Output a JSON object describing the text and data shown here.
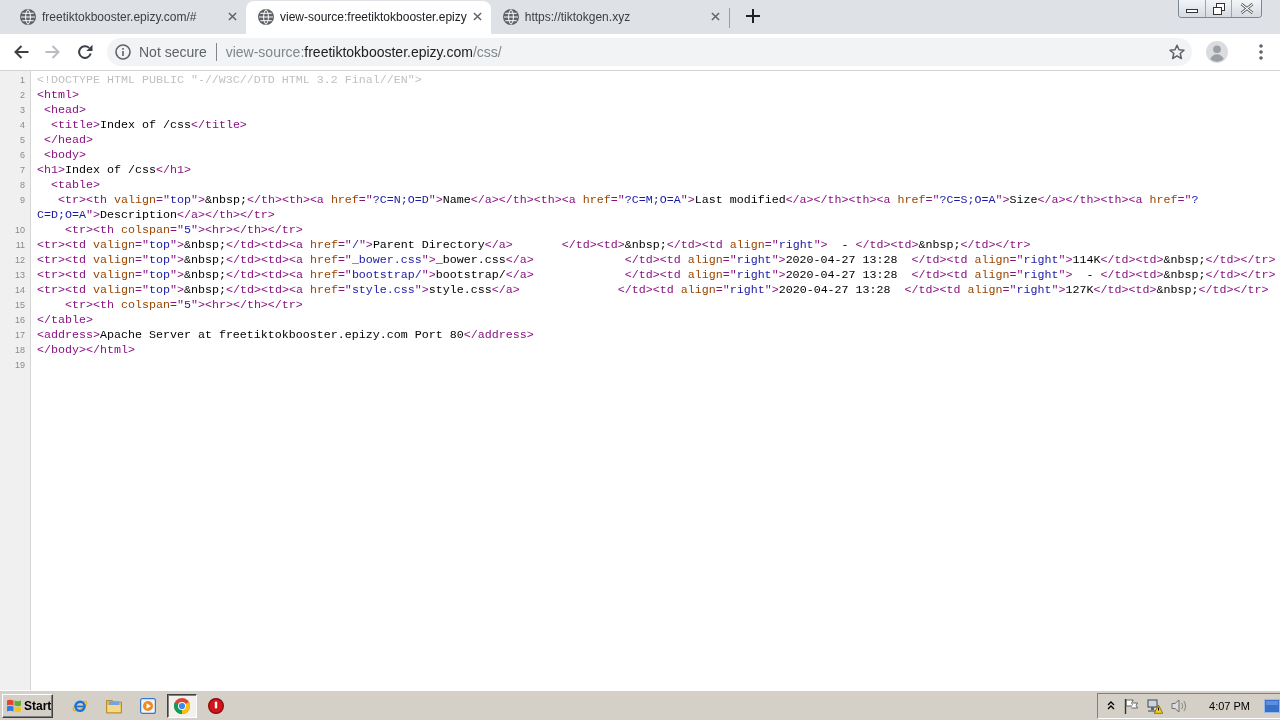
{
  "tabs": [
    {
      "title": "freetiktokbooster.epizy.com/#",
      "selected": false
    },
    {
      "title": "view-source:freetiktokbooster.epizy",
      "selected": true
    },
    {
      "title": "https://tiktokgen.xyz",
      "selected": false
    }
  ],
  "nav_buttons": [
    {
      "kind": "back",
      "disabled": false
    },
    {
      "kind": "forward",
      "disabled": true
    },
    {
      "kind": "reload",
      "disabled": false
    }
  ],
  "address_bar": {
    "security": "Not secure",
    "url": {
      "scheme": "view-source:",
      "host": "freetiktokbooster.epizy.com",
      "path": "/css/"
    }
  },
  "source": {
    "lines": [
      {
        "number": "1",
        "tokens": [
          {
            "kind": "doctype",
            "text": "<!DOCTYPE HTML PUBLIC \"-//W3C//DTD HTML 3.2 Final//EN\">"
          }
        ]
      },
      {
        "number": "2",
        "tokens": [
          {
            "kind": "tag",
            "text": "<html>"
          }
        ]
      },
      {
        "number": "3",
        "tokens": [
          {
            "kind": "tag",
            "text": " <head>"
          }
        ]
      },
      {
        "number": "4",
        "tokens": [
          {
            "kind": "tag",
            "text": "  <title>"
          },
          {
            "kind": "text",
            "text": "Index of /css"
          },
          {
            "kind": "tag",
            "text": "</title>"
          }
        ]
      },
      {
        "number": "5",
        "tokens": [
          {
            "kind": "tag",
            "text": " </head>"
          }
        ]
      },
      {
        "number": "6",
        "tokens": [
          {
            "kind": "tag",
            "text": " <body>"
          }
        ]
      },
      {
        "number": "7",
        "tokens": [
          {
            "kind": "tag",
            "text": "<h1>"
          },
          {
            "kind": "text",
            "text": "Index of /css"
          },
          {
            "kind": "tag",
            "text": "</h1>"
          }
        ]
      },
      {
        "number": "8",
        "tokens": [
          {
            "kind": "tag",
            "text": "  <table>"
          }
        ]
      },
      {
        "number": "9",
        "tokens": [
          {
            "kind": "tag",
            "text": "   <tr><th "
          },
          {
            "kind": "attr",
            "text": "valign"
          },
          {
            "kind": "tag",
            "text": "=\""
          },
          {
            "kind": "value",
            "text": "top"
          },
          {
            "kind": "tag",
            "text": "\">"
          },
          {
            "kind": "text",
            "text": "&nbsp;"
          },
          {
            "kind": "tag",
            "text": "</th><th><a "
          },
          {
            "kind": "attr",
            "text": "href"
          },
          {
            "kind": "tag",
            "text": "=\""
          },
          {
            "kind": "value",
            "text": "?C=N;O=D"
          },
          {
            "kind": "tag",
            "text": "\">"
          },
          {
            "kind": "text",
            "text": "Name"
          },
          {
            "kind": "tag",
            "text": "</a></th><th><a "
          },
          {
            "kind": "attr",
            "text": "href"
          },
          {
            "kind": "tag",
            "text": "=\""
          },
          {
            "kind": "value",
            "text": "?C=M;O=A"
          },
          {
            "kind": "tag",
            "text": "\">"
          },
          {
            "kind": "text",
            "text": "Last modified"
          },
          {
            "kind": "tag",
            "text": "</a></th><th><a "
          },
          {
            "kind": "attr",
            "text": "href"
          },
          {
            "kind": "tag",
            "text": "=\""
          },
          {
            "kind": "value",
            "text": "?C=S;O=A"
          },
          {
            "kind": "tag",
            "text": "\">"
          },
          {
            "kind": "text",
            "text": "Size"
          },
          {
            "kind": "tag",
            "text": "</a></th><th><a "
          },
          {
            "kind": "attr",
            "text": "href"
          },
          {
            "kind": "tag",
            "text": "=\""
          },
          {
            "kind": "value",
            "text": "?"
          }
        ],
        "wrapped_tokens": [
          {
            "kind": "value",
            "text": "C=D;O=A"
          },
          {
            "kind": "tag",
            "text": "\">"
          },
          {
            "kind": "text",
            "text": "Description"
          },
          {
            "kind": "tag",
            "text": "</a></th></tr>"
          }
        ]
      },
      {
        "number": "10",
        "tokens": [
          {
            "kind": "tag",
            "text": "    <tr><th "
          },
          {
            "kind": "attr",
            "text": "colspan"
          },
          {
            "kind": "tag",
            "text": "=\""
          },
          {
            "kind": "value",
            "text": "5"
          },
          {
            "kind": "tag",
            "text": "\"><hr></th></tr>"
          }
        ]
      },
      {
        "number": "11",
        "tokens": [
          {
            "kind": "tag",
            "text": "<tr><td "
          },
          {
            "kind": "attr",
            "text": "valign"
          },
          {
            "kind": "tag",
            "text": "=\""
          },
          {
            "kind": "value",
            "text": "top"
          },
          {
            "kind": "tag",
            "text": "\">"
          },
          {
            "kind": "text",
            "text": "&nbsp;"
          },
          {
            "kind": "tag",
            "text": "</td><td><a "
          },
          {
            "kind": "attr",
            "text": "href"
          },
          {
            "kind": "tag",
            "text": "=\""
          },
          {
            "kind": "value",
            "text": "/"
          },
          {
            "kind": "tag",
            "text": "\">"
          },
          {
            "kind": "text",
            "text": "Parent Directory"
          },
          {
            "kind": "tag",
            "text": "</a>       </td><td>"
          },
          {
            "kind": "text",
            "text": "&nbsp;"
          },
          {
            "kind": "tag",
            "text": "</td><td "
          },
          {
            "kind": "attr",
            "text": "align"
          },
          {
            "kind": "tag",
            "text": "=\""
          },
          {
            "kind": "value",
            "text": "right"
          },
          {
            "kind": "tag",
            "text": "\">"
          },
          {
            "kind": "text",
            "text": "  - "
          },
          {
            "kind": "tag",
            "text": "</td><td>"
          },
          {
            "kind": "text",
            "text": "&nbsp;"
          },
          {
            "kind": "tag",
            "text": "</td></tr>"
          }
        ]
      },
      {
        "number": "12",
        "tokens": [
          {
            "kind": "tag",
            "text": "<tr><td "
          },
          {
            "kind": "attr",
            "text": "valign"
          },
          {
            "kind": "tag",
            "text": "=\""
          },
          {
            "kind": "value",
            "text": "top"
          },
          {
            "kind": "tag",
            "text": "\">"
          },
          {
            "kind": "text",
            "text": "&nbsp;"
          },
          {
            "kind": "tag",
            "text": "</td><td><a "
          },
          {
            "kind": "attr",
            "text": "href"
          },
          {
            "kind": "tag",
            "text": "=\""
          },
          {
            "kind": "value",
            "text": "_bower.css"
          },
          {
            "kind": "tag",
            "text": "\">"
          },
          {
            "kind": "text",
            "text": "_bower.css"
          },
          {
            "kind": "tag",
            "text": "</a>             </td><td "
          },
          {
            "kind": "attr",
            "text": "align"
          },
          {
            "kind": "tag",
            "text": "=\""
          },
          {
            "kind": "value",
            "text": "right"
          },
          {
            "kind": "tag",
            "text": "\">"
          },
          {
            "kind": "text",
            "text": "2020-04-27 13:28  "
          },
          {
            "kind": "tag",
            "text": "</td><td "
          },
          {
            "kind": "attr",
            "text": "align"
          },
          {
            "kind": "tag",
            "text": "=\""
          },
          {
            "kind": "value",
            "text": "right"
          },
          {
            "kind": "tag",
            "text": "\">"
          },
          {
            "kind": "text",
            "text": "114K"
          },
          {
            "kind": "tag",
            "text": "</td><td>"
          },
          {
            "kind": "text",
            "text": "&nbsp;"
          },
          {
            "kind": "tag",
            "text": "</td></tr>"
          }
        ]
      },
      {
        "number": "13",
        "tokens": [
          {
            "kind": "tag",
            "text": "<tr><td "
          },
          {
            "kind": "attr",
            "text": "valign"
          },
          {
            "kind": "tag",
            "text": "=\""
          },
          {
            "kind": "value",
            "text": "top"
          },
          {
            "kind": "tag",
            "text": "\">"
          },
          {
            "kind": "text",
            "text": "&nbsp;"
          },
          {
            "kind": "tag",
            "text": "</td><td><a "
          },
          {
            "kind": "attr",
            "text": "href"
          },
          {
            "kind": "tag",
            "text": "=\""
          },
          {
            "kind": "value",
            "text": "bootstrap/"
          },
          {
            "kind": "tag",
            "text": "\">"
          },
          {
            "kind": "text",
            "text": "bootstrap/"
          },
          {
            "kind": "tag",
            "text": "</a>             </td><td "
          },
          {
            "kind": "attr",
            "text": "align"
          },
          {
            "kind": "tag",
            "text": "=\""
          },
          {
            "kind": "value",
            "text": "right"
          },
          {
            "kind": "tag",
            "text": "\">"
          },
          {
            "kind": "text",
            "text": "2020-04-27 13:28  "
          },
          {
            "kind": "tag",
            "text": "</td><td "
          },
          {
            "kind": "attr",
            "text": "align"
          },
          {
            "kind": "tag",
            "text": "=\""
          },
          {
            "kind": "value",
            "text": "right"
          },
          {
            "kind": "tag",
            "text": "\">"
          },
          {
            "kind": "text",
            "text": "  - "
          },
          {
            "kind": "tag",
            "text": "</td><td>"
          },
          {
            "kind": "text",
            "text": "&nbsp;"
          },
          {
            "kind": "tag",
            "text": "</td></tr>"
          }
        ]
      },
      {
        "number": "14",
        "tokens": [
          {
            "kind": "tag",
            "text": "<tr><td "
          },
          {
            "kind": "attr",
            "text": "valign"
          },
          {
            "kind": "tag",
            "text": "=\""
          },
          {
            "kind": "value",
            "text": "top"
          },
          {
            "kind": "tag",
            "text": "\">"
          },
          {
            "kind": "text",
            "text": "&nbsp;"
          },
          {
            "kind": "tag",
            "text": "</td><td><a "
          },
          {
            "kind": "attr",
            "text": "href"
          },
          {
            "kind": "tag",
            "text": "=\""
          },
          {
            "kind": "value",
            "text": "style.css"
          },
          {
            "kind": "tag",
            "text": "\">"
          },
          {
            "kind": "text",
            "text": "style.css"
          },
          {
            "kind": "tag",
            "text": "</a>              </td><td "
          },
          {
            "kind": "attr",
            "text": "align"
          },
          {
            "kind": "tag",
            "text": "=\""
          },
          {
            "kind": "value",
            "text": "right"
          },
          {
            "kind": "tag",
            "text": "\">"
          },
          {
            "kind": "text",
            "text": "2020-04-27 13:28  "
          },
          {
            "kind": "tag",
            "text": "</td><td "
          },
          {
            "kind": "attr",
            "text": "align"
          },
          {
            "kind": "tag",
            "text": "=\""
          },
          {
            "kind": "value",
            "text": "right"
          },
          {
            "kind": "tag",
            "text": "\">"
          },
          {
            "kind": "text",
            "text": "127K"
          },
          {
            "kind": "tag",
            "text": "</td><td>"
          },
          {
            "kind": "text",
            "text": "&nbsp;"
          },
          {
            "kind": "tag",
            "text": "</td></tr>"
          }
        ]
      },
      {
        "number": "15",
        "tokens": [
          {
            "kind": "tag",
            "text": "    <tr><th "
          },
          {
            "kind": "attr",
            "text": "colspan"
          },
          {
            "kind": "tag",
            "text": "=\""
          },
          {
            "kind": "value",
            "text": "5"
          },
          {
            "kind": "tag",
            "text": "\"><hr></th></tr>"
          }
        ]
      },
      {
        "number": "16",
        "tokens": [
          {
            "kind": "tag",
            "text": "</table>"
          }
        ]
      },
      {
        "number": "17",
        "tokens": [
          {
            "kind": "tag",
            "text": "<address>"
          },
          {
            "kind": "text",
            "text": "Apache Server at freetiktokbooster.epizy.com Port 80"
          },
          {
            "kind": "tag",
            "text": "</address>"
          }
        ]
      },
      {
        "number": "18",
        "tokens": [
          {
            "kind": "tag",
            "text": "</body></html>"
          }
        ]
      },
      {
        "number": "19"
      }
    ]
  },
  "taskbar": {
    "start_label": "Start",
    "apps": [
      {
        "kind": "ie",
        "selected": false
      },
      {
        "kind": "folder",
        "selected": false
      },
      {
        "kind": "media",
        "selected": false
      },
      {
        "kind": "chrome",
        "selected": true
      },
      {
        "kind": "stop",
        "selected": false
      }
    ],
    "clock": "4:07 PM"
  }
}
